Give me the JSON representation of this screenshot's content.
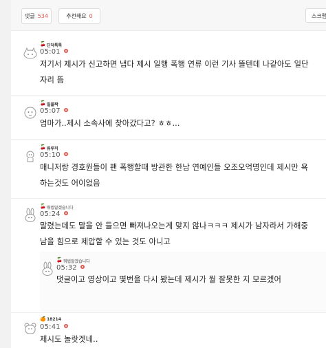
{
  "tabs": {
    "comments_label": "댓글",
    "comments_count": "534",
    "recommend_label": "추천해요",
    "recommend_count": "0",
    "scrap_label": "스크랩"
  },
  "comments": [
    {
      "nick": "딘닥톡톡",
      "time": "05:01",
      "text": "저기서 제시가 신고하면 냅다 제시 일행 폭행 연류 이런 기사 뜰텐데 나같아도 일단 자리 뜸",
      "avatar_icon": "cat-face-icon"
    },
    {
      "nick": "밀풀짝",
      "time": "05:07",
      "text": "엄마가..제시 소속사에 찾아갔다고? ㅎㅎ...",
      "avatar_icon": "round-face-icon"
    },
    {
      "nick": "류루히",
      "time": "05:10",
      "text": "매니저랑 경호원들이 팬 폭행할때 방관한 한남 연예인들 오조오억명인데 제시만 욕하는것도 어이없음",
      "avatar_icon": "small-character-icon"
    },
    {
      "nick": "뭐법알겠습니다",
      "time": "05:24",
      "text": "말렸는데도 말을 안 들으면 빠져나오는게 맞지 않나ㅋㅋㅋ 제시가 남자라서 가해중남을 힘으로 제압할 수 있는 것도 아니고",
      "avatar_icon": "rabbit-icon"
    },
    {
      "nick": "뭐법알겠습니다",
      "time": "05:32",
      "text": "댓글이고 영상이고 몇번을 다시 봤는데 제시가 뭘 잘못한 지 모르겠어",
      "avatar_icon": "rabbit-icon",
      "reply": true
    },
    {
      "nick": "18214",
      "time": "05:41",
      "text": "제시도 놀랏겟네..",
      "avatar_icon": "bear-icon"
    }
  ]
}
